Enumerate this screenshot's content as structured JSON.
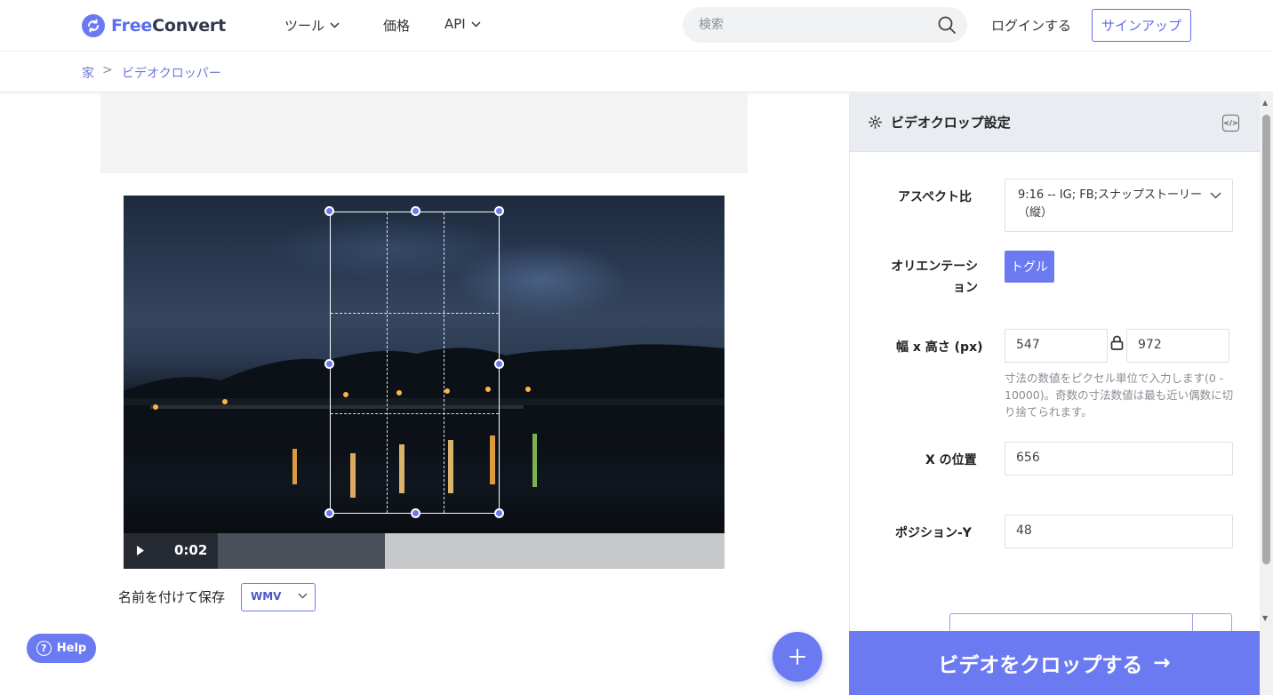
{
  "header": {
    "logo_prefix": "Free",
    "logo_suffix": "Convert",
    "nav": [
      {
        "label": "ツール",
        "has_dropdown": true
      },
      {
        "label": "価格",
        "has_dropdown": false
      },
      {
        "label": "API",
        "has_dropdown": true
      }
    ],
    "search_placeholder": "検索",
    "login": "ログインする",
    "signup": "サインアップ"
  },
  "breadcrumb": {
    "home": "家",
    "separator": ">",
    "current": "ビデオクロッパー"
  },
  "player": {
    "time": "0:02",
    "progress": 0.33
  },
  "save_as": {
    "label": "名前を付けて保存",
    "format": "WMV"
  },
  "help": {
    "label": "Help",
    "glyph": "?"
  },
  "fab": {
    "glyph": "+"
  },
  "settings": {
    "title": "ビデオクロップ設定",
    "aspect_label": "アスペクト比",
    "aspect_value": "9:16 -- IG; FB;スナップストーリー（縦）",
    "orientation_label": "オリエンテーション",
    "toggle_label": "トグル",
    "size_label": "幅 x 高さ (px)",
    "width": "547",
    "height": "972",
    "size_hint": "寸法の数値をピクセル単位で入力します(0 - 10000)。奇数の寸法数値は最も近い偶数に切り捨てられます。",
    "x_label": "X の位置",
    "x_value": "656",
    "y_label": "ポジション-Y",
    "y_value": "48",
    "code_glyph": "</>"
  },
  "action": {
    "crop_label": "ビデオをクロップする",
    "arrow": "→"
  },
  "colors": {
    "accent": "#6c7af2",
    "accent_text": "#5b6cf0",
    "panel_head": "#e9ecf0"
  }
}
